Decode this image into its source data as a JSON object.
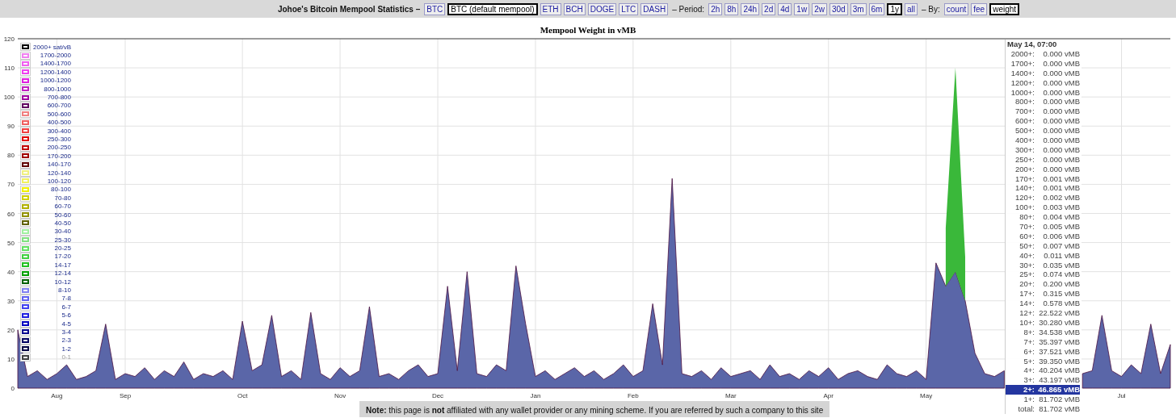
{
  "header": {
    "title": "Johoe's Bitcoin Mempool Statistics –",
    "coins": [
      {
        "label": "BTC",
        "selected": false
      },
      {
        "label": "BTC (default mempool)",
        "selected": true
      },
      {
        "label": "ETH",
        "selected": false
      },
      {
        "label": "BCH",
        "selected": false
      },
      {
        "label": "DOGE",
        "selected": false
      },
      {
        "label": "LTC",
        "selected": false
      },
      {
        "label": "DASH",
        "selected": false
      }
    ],
    "period_label": "– Period:",
    "periods": [
      {
        "label": "2h",
        "selected": false
      },
      {
        "label": "8h",
        "selected": false
      },
      {
        "label": "24h",
        "selected": false
      },
      {
        "label": "2d",
        "selected": false
      },
      {
        "label": "4d",
        "selected": false
      },
      {
        "label": "1w",
        "selected": false
      },
      {
        "label": "2w",
        "selected": false
      },
      {
        "label": "30d",
        "selected": false
      },
      {
        "label": "3m",
        "selected": false
      },
      {
        "label": "6m",
        "selected": false
      },
      {
        "label": "1y",
        "selected": true
      },
      {
        "label": "all",
        "selected": false
      }
    ],
    "by_label": "– By:",
    "by": [
      {
        "label": "count",
        "selected": false
      },
      {
        "label": "fee",
        "selected": false
      },
      {
        "label": "weight",
        "selected": true
      }
    ]
  },
  "chart": {
    "title": "Mempool Weight in vMB",
    "chart_data": {
      "type": "area",
      "stacked": true,
      "grid": true,
      "ylim": [
        0,
        120
      ],
      "yticks": [
        0,
        10,
        20,
        30,
        40,
        50,
        60,
        70,
        80,
        90,
        100,
        110,
        120
      ],
      "categories": [
        null,
        null,
        null,
        null,
        "Aug",
        null,
        null,
        null,
        null,
        null,
        null,
        "Sep",
        null,
        null,
        null,
        null,
        null,
        null,
        null,
        null,
        null,
        null,
        null,
        "Oct",
        null,
        null,
        null,
        null,
        null,
        null,
        null,
        null,
        null,
        "Nov",
        null,
        null,
        null,
        null,
        null,
        null,
        null,
        null,
        null,
        "Dec",
        null,
        null,
        null,
        null,
        null,
        null,
        null,
        null,
        null,
        "Jan",
        null,
        null,
        null,
        null,
        null,
        null,
        null,
        null,
        null,
        "Feb",
        null,
        null,
        null,
        null,
        null,
        null,
        null,
        null,
        null,
        "Mar",
        null,
        null,
        null,
        null,
        null,
        null,
        null,
        null,
        null,
        "Apr",
        null,
        null,
        null,
        null,
        null,
        null,
        null,
        null,
        null,
        "May",
        null,
        null,
        null,
        null,
        null,
        null,
        null,
        null,
        null,
        null,
        null,
        null,
        null,
        null,
        null,
        null,
        null,
        null,
        null,
        "Jul",
        null,
        null,
        null,
        null,
        null
      ],
      "series": [
        {
          "color": "#5a66a8",
          "values": [
            20,
            4,
            6,
            3,
            5,
            8,
            3,
            4,
            6,
            22,
            3,
            5,
            4,
            7,
            3,
            6,
            4,
            9,
            3,
            5,
            4,
            6,
            3,
            23,
            6,
            8,
            25,
            4,
            6,
            3,
            26,
            5,
            3,
            7,
            4,
            6,
            28,
            4,
            5,
            3,
            6,
            8,
            4,
            5,
            35,
            6,
            40,
            5,
            4,
            8,
            6,
            42,
            22,
            4,
            6,
            3,
            5,
            7,
            4,
            6,
            3,
            5,
            8,
            4,
            6,
            29,
            8,
            72,
            5,
            4,
            6,
            3,
            7,
            4,
            5,
            6,
            3,
            8,
            4,
            5,
            3,
            6,
            4,
            7,
            3,
            5,
            6,
            4,
            3,
            8,
            5,
            4,
            6,
            3,
            43,
            35,
            40,
            30,
            12,
            5,
            4,
            6,
            null,
            null,
            null,
            null,
            null,
            null,
            null,
            5,
            6,
            25,
            6,
            4,
            8,
            5,
            22,
            5,
            15
          ]
        },
        {
          "color": "#3ab83a",
          "values": [
            null,
            null,
            null,
            null,
            null,
            null,
            null,
            null,
            null,
            null,
            null,
            null,
            null,
            null,
            null,
            null,
            null,
            null,
            null,
            null,
            null,
            null,
            null,
            null,
            null,
            null,
            null,
            null,
            null,
            null,
            null,
            null,
            null,
            null,
            null,
            null,
            null,
            null,
            null,
            null,
            null,
            null,
            null,
            null,
            null,
            null,
            null,
            null,
            null,
            null,
            null,
            null,
            null,
            null,
            null,
            null,
            null,
            null,
            null,
            null,
            null,
            null,
            null,
            null,
            null,
            null,
            null,
            null,
            null,
            null,
            null,
            null,
            null,
            null,
            null,
            null,
            null,
            null,
            null,
            null,
            null,
            null,
            null,
            null,
            null,
            null,
            null,
            null,
            null,
            null,
            null,
            null,
            null,
            null,
            null,
            20,
            70,
            15,
            null,
            null,
            null,
            null,
            null,
            null,
            null,
            null,
            null,
            null,
            null,
            null,
            null,
            null,
            null,
            null,
            null,
            null,
            null,
            null,
            null
          ]
        }
      ]
    },
    "legend": [
      {
        "label": "2000+ sat/vB",
        "color": "#000000",
        "hidden": false
      },
      {
        "label": "1700-2000",
        "color": "#f080f0",
        "hidden": false
      },
      {
        "label": "1400-1700",
        "color": "#f060f0",
        "hidden": false
      },
      {
        "label": "1200-1400",
        "color": "#f040f0",
        "hidden": false
      },
      {
        "label": "1000-1200",
        "color": "#e020e0",
        "hidden": false
      },
      {
        "label": "800-1000",
        "color": "#c020c0",
        "hidden": false
      },
      {
        "label": "700-800",
        "color": "#a000a0",
        "hidden": false
      },
      {
        "label": "600-700",
        "color": "#600060",
        "hidden": false
      },
      {
        "label": "500-600",
        "color": "#f08080",
        "hidden": false
      },
      {
        "label": "400-500",
        "color": "#f06060",
        "hidden": false
      },
      {
        "label": "300-400",
        "color": "#f04040",
        "hidden": false
      },
      {
        "label": "250-300",
        "color": "#e00000",
        "hidden": false
      },
      {
        "label": "200-250",
        "color": "#c00000",
        "hidden": false
      },
      {
        "label": "170-200",
        "color": "#a00000",
        "hidden": false
      },
      {
        "label": "140-170",
        "color": "#600000",
        "hidden": false
      },
      {
        "label": "120-140",
        "color": "#f0f080",
        "hidden": false
      },
      {
        "label": "100-120",
        "color": "#f0f060",
        "hidden": false
      },
      {
        "label": "80-100",
        "color": "#f0f000",
        "hidden": false
      },
      {
        "label": "70-80",
        "color": "#d0d000",
        "hidden": false
      },
      {
        "label": "60-70",
        "color": "#b0b000",
        "hidden": false
      },
      {
        "label": "50-60",
        "color": "#909000",
        "hidden": false
      },
      {
        "label": "40-50",
        "color": "#606000",
        "hidden": false
      },
      {
        "label": "30-40",
        "color": "#a0f0a0",
        "hidden": false
      },
      {
        "label": "25-30",
        "color": "#80e080",
        "hidden": false
      },
      {
        "label": "20-25",
        "color": "#60e060",
        "hidden": false
      },
      {
        "label": "17-20",
        "color": "#40d040",
        "hidden": false
      },
      {
        "label": "14-17",
        "color": "#20c020",
        "hidden": false
      },
      {
        "label": "12-14",
        "color": "#00a000",
        "hidden": false
      },
      {
        "label": "10-12",
        "color": "#006000",
        "hidden": false
      },
      {
        "label": "8-10",
        "color": "#8080f0",
        "hidden": false
      },
      {
        "label": "7-8",
        "color": "#6060f0",
        "hidden": false
      },
      {
        "label": "6-7",
        "color": "#4040f0",
        "hidden": false
      },
      {
        "label": "5-6",
        "color": "#2020e0",
        "hidden": false
      },
      {
        "label": "4-5",
        "color": "#0000c0",
        "hidden": false
      },
      {
        "label": "3-4",
        "color": "#000090",
        "hidden": false
      },
      {
        "label": "2-3",
        "color": "#000060",
        "hidden": false
      },
      {
        "label": "1-2",
        "color": "#000040",
        "hidden": false
      },
      {
        "label": "0-1",
        "color": "#404040",
        "hidden": true
      }
    ],
    "tooltip": {
      "title": "May 14, 07:00",
      "rows": [
        {
          "label": "2000+:",
          "value": "0.000 vMB",
          "highlighted": false
        },
        {
          "label": "1700+:",
          "value": "0.000 vMB",
          "highlighted": false
        },
        {
          "label": "1400+:",
          "value": "0.000 vMB",
          "highlighted": false
        },
        {
          "label": "1200+:",
          "value": "0.000 vMB",
          "highlighted": false
        },
        {
          "label": "1000+:",
          "value": "0.000 vMB",
          "highlighted": false
        },
        {
          "label": "800+:",
          "value": "0.000 vMB",
          "highlighted": false
        },
        {
          "label": "700+:",
          "value": "0.000 vMB",
          "highlighted": false
        },
        {
          "label": "600+:",
          "value": "0.000 vMB",
          "highlighted": false
        },
        {
          "label": "500+:",
          "value": "0.000 vMB",
          "highlighted": false
        },
        {
          "label": "400+:",
          "value": "0.000 vMB",
          "highlighted": false
        },
        {
          "label": "300+:",
          "value": "0.000 vMB",
          "highlighted": false
        },
        {
          "label": "250+:",
          "value": "0.000 vMB",
          "highlighted": false
        },
        {
          "label": "200+:",
          "value": "0.000 vMB",
          "highlighted": false
        },
        {
          "label": "170+:",
          "value": "0.001 vMB",
          "highlighted": false
        },
        {
          "label": "140+:",
          "value": "0.001 vMB",
          "highlighted": false
        },
        {
          "label": "120+:",
          "value": "0.002 vMB",
          "highlighted": false
        },
        {
          "label": "100+:",
          "value": "0.003 vMB",
          "highlighted": false
        },
        {
          "label": "80+:",
          "value": "0.004 vMB",
          "highlighted": false
        },
        {
          "label": "70+:",
          "value": "0.005 vMB",
          "highlighted": false
        },
        {
          "label": "60+:",
          "value": "0.006 vMB",
          "highlighted": false
        },
        {
          "label": "50+:",
          "value": "0.007 vMB",
          "highlighted": false
        },
        {
          "label": "40+:",
          "value": "0.011 vMB",
          "highlighted": false
        },
        {
          "label": "30+:",
          "value": "0.035 vMB",
          "highlighted": false
        },
        {
          "label": "25+:",
          "value": "0.074 vMB",
          "highlighted": false
        },
        {
          "label": "20+:",
          "value": "0.200 vMB",
          "highlighted": false
        },
        {
          "label": "17+:",
          "value": "0.315 vMB",
          "highlighted": false
        },
        {
          "label": "14+:",
          "value": "0.578 vMB",
          "highlighted": false
        },
        {
          "label": "12+:",
          "value": "22.522 vMB",
          "highlighted": false
        },
        {
          "label": "10+:",
          "value": "30.280 vMB",
          "highlighted": false
        },
        {
          "label": "8+:",
          "value": "34.538 vMB",
          "highlighted": false
        },
        {
          "label": "7+:",
          "value": "35.397 vMB",
          "highlighted": false
        },
        {
          "label": "6+:",
          "value": "37.521 vMB",
          "highlighted": false
        },
        {
          "label": "5+:",
          "value": "39.350 vMB",
          "highlighted": false
        },
        {
          "label": "4+:",
          "value": "40.204 vMB",
          "highlighted": false
        },
        {
          "label": "3+:",
          "value": "43.197 vMB",
          "highlighted": false
        },
        {
          "label": "2+:",
          "value": "46.865 vMB",
          "highlighted": true
        },
        {
          "label": "1+:",
          "value": "81.702 vMB",
          "highlighted": false
        },
        {
          "label": "total:",
          "value": "81.702 vMB",
          "highlighted": false
        }
      ]
    }
  },
  "note": "**Note:** this page is **not** affiliated with any wallet provider or any mining scheme. If you are referred by such a company to this site"
}
